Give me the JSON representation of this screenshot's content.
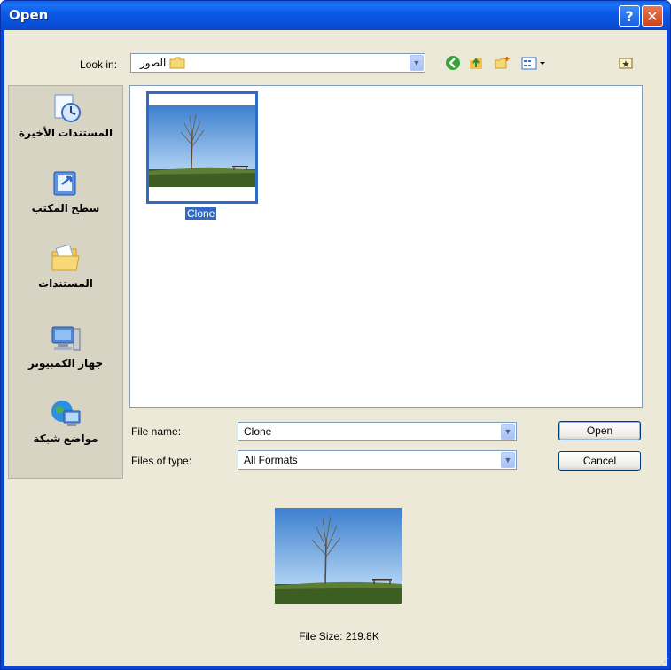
{
  "window": {
    "title": "Open",
    "help_label": "?",
    "close_label": "✕"
  },
  "toolbar": {
    "lookin_label": "Look in:",
    "lookin_value": "الصور",
    "icons": [
      "back-icon",
      "up-folder-icon",
      "new-folder-icon",
      "views-menu-icon",
      "pin-icon"
    ]
  },
  "places": [
    {
      "label": "المستندات الأخيرة",
      "icon": "recent-documents-icon"
    },
    {
      "label": "سطح المكتب",
      "icon": "desktop-icon"
    },
    {
      "label": "المستندات",
      "icon": "documents-icon"
    },
    {
      "label": "جهاز الكمبيوتر",
      "icon": "computer-icon"
    },
    {
      "label": "مواضع شبكة",
      "icon": "network-places-icon"
    }
  ],
  "files": [
    {
      "name": "Clone",
      "selected": true
    }
  ],
  "form": {
    "filename_label": "File name:",
    "filename_value": "Clone",
    "filetype_label": "Files of type:",
    "filetype_value": "All Formats",
    "open_label": "Open",
    "cancel_label": "Cancel"
  },
  "preview": {
    "filesize_text": "File Size: 219.8K"
  },
  "colors": {
    "titlebar": "#0a58e6",
    "dialog_bg": "#ece9d8",
    "selection": "#316ac5"
  }
}
